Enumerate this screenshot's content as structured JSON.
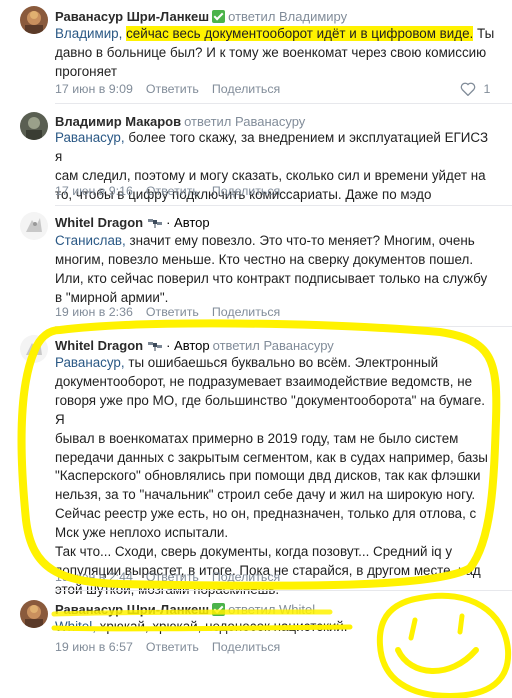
{
  "comments": [
    {
      "author": "Раванасур Шри-Ланкеш",
      "replied": "ответил Владимиру",
      "mention": "Владимир,",
      "highlight": "сейчас весь документооборот идёт и в цифровом виде.",
      "rest1": " Ты",
      "lines": [
        "давно в больнице был? И к тому же военкомат через свою комиссию",
        "прогоняет"
      ],
      "time": "17 июн в 9:09",
      "reply": "Ответить",
      "share": "Поделиться",
      "likes": "1"
    },
    {
      "author": "Владимир Макаров",
      "replied": "ответил Раванасуру",
      "mention": "Раванасур,",
      "first": " более того скажу, за внедрением и эксплуатацией ЕГИСЗ я",
      "lines": [
        "сам следил, поэтому и могу сказать, сколько сил и времени уйдет на",
        "то, чтобы в цифру подключить комиссариаты. Даже по мэдо"
      ],
      "time": "17 июн в 9:16",
      "reply": "Ответить",
      "share": "Поделиться"
    },
    {
      "author": "Whitel Dragon",
      "badge": "· Автор",
      "mention": "Станислав,",
      "first": " значит ему повезло. Это что-то меняет? Многим, очень",
      "lines": [
        "многим, повезло меньше. Кто честно на сверку документов пошел.",
        "Или, кто сейчас поверил что контракт подписывает только на службу",
        "в \"мирной армии\"."
      ],
      "time": "19 июн в 2:36",
      "reply": "Ответить",
      "share": "Поделиться"
    },
    {
      "author": "Whitel Dragon",
      "badge": "· Автор",
      "replied": "ответил Раванасуру",
      "mention": "Раванасур,",
      "first": " ты ошибаешься буквально во всём. Электронный",
      "lines": [
        "документооборот, не подразумевает взаимодействие ведомств, не",
        "говоря уже про МО, где большинство \"документооборота\" на бумаге. Я",
        "бывал в военкоматах примерно в 2019 году, там не было систем",
        "передачи данных с закрытым сегментом, как в судах например, базы",
        "\"Касперского\" обновлялись при помощи двд дисков, так как флэшки",
        "нельзя, за то \"начальник\" строил себе дачу и жил на широкую ногу.",
        "Сейчас реестр уже есть, но он, предназначен, только для отлова, с",
        "Мск уже неплохо испытали.",
        "Так что... Сходи, сверь документы, когда позовут... Средний iq у",
        "популяции вырастет, в итоге. Пока не старайся, в другом месте, над",
        "этой шуткой, мозгами пораскинешь."
      ],
      "time": "19 июн в 2:44",
      "reply": "Ответить",
      "share": "Поделиться"
    },
    {
      "author": "Раванасур Шри-Ланкеш",
      "replied": "ответил Whitel",
      "mention": "Whitel,",
      "first": " хрюкай, хрюкай, недоносок нацистский.",
      "time": "19 июн в 6:57",
      "reply": "Ответить",
      "share": "Поделиться"
    }
  ]
}
